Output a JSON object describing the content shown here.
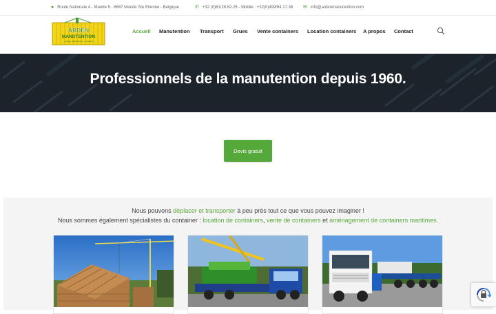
{
  "topbar": {
    "address": "Route Nationale 4 - Mande 5 - 6687 Mande Ste Etienne - Belgique",
    "phone": "+32 (0)61/28.82.25 - Mobile : +32(0)499/64.17.36",
    "email": "info@ardenmanutention.com"
  },
  "logo": {
    "text": "ARDEN MANUTENTION",
    "tagline": "Levage - Manutention - Transport",
    "color": "#f2d41a"
  },
  "nav": {
    "items": [
      "Accueil",
      "Manutention",
      "Transport",
      "Grues",
      "Vente containers",
      "Location containers",
      "A propos",
      "Contact"
    ],
    "active": "Accueil",
    "active_color": "#5aaa3c"
  },
  "hero": {
    "title": "Professionnels de la manutention depuis 1960."
  },
  "cta": {
    "label": "Devis gratuit",
    "color": "#55a83a"
  },
  "services": {
    "line1_prefix": "Nous pouvons ",
    "line1_link": "déplacer et transporter",
    "line1_suffix": " à peu près tout ce que vous pouvez imaginer !",
    "line2_prefix": "Nous sommes également spécialistes du container : ",
    "line2_link1": "location de containers",
    "line2_sep1": ", ",
    "line2_link2": "vente de containers",
    "line2_sep2": " et ",
    "line2_link3": "aménagement de containers maritimes",
    "line2_end": "."
  },
  "cards": [
    {
      "subject": "crane-house-construction"
    },
    {
      "subject": "truck-crane-machinery"
    },
    {
      "subject": "truck-flatbed-trailer"
    }
  ],
  "icons": [
    "map-pin-icon",
    "phone-icon",
    "envelope-icon",
    "search-icon",
    "recaptcha-icon"
  ]
}
